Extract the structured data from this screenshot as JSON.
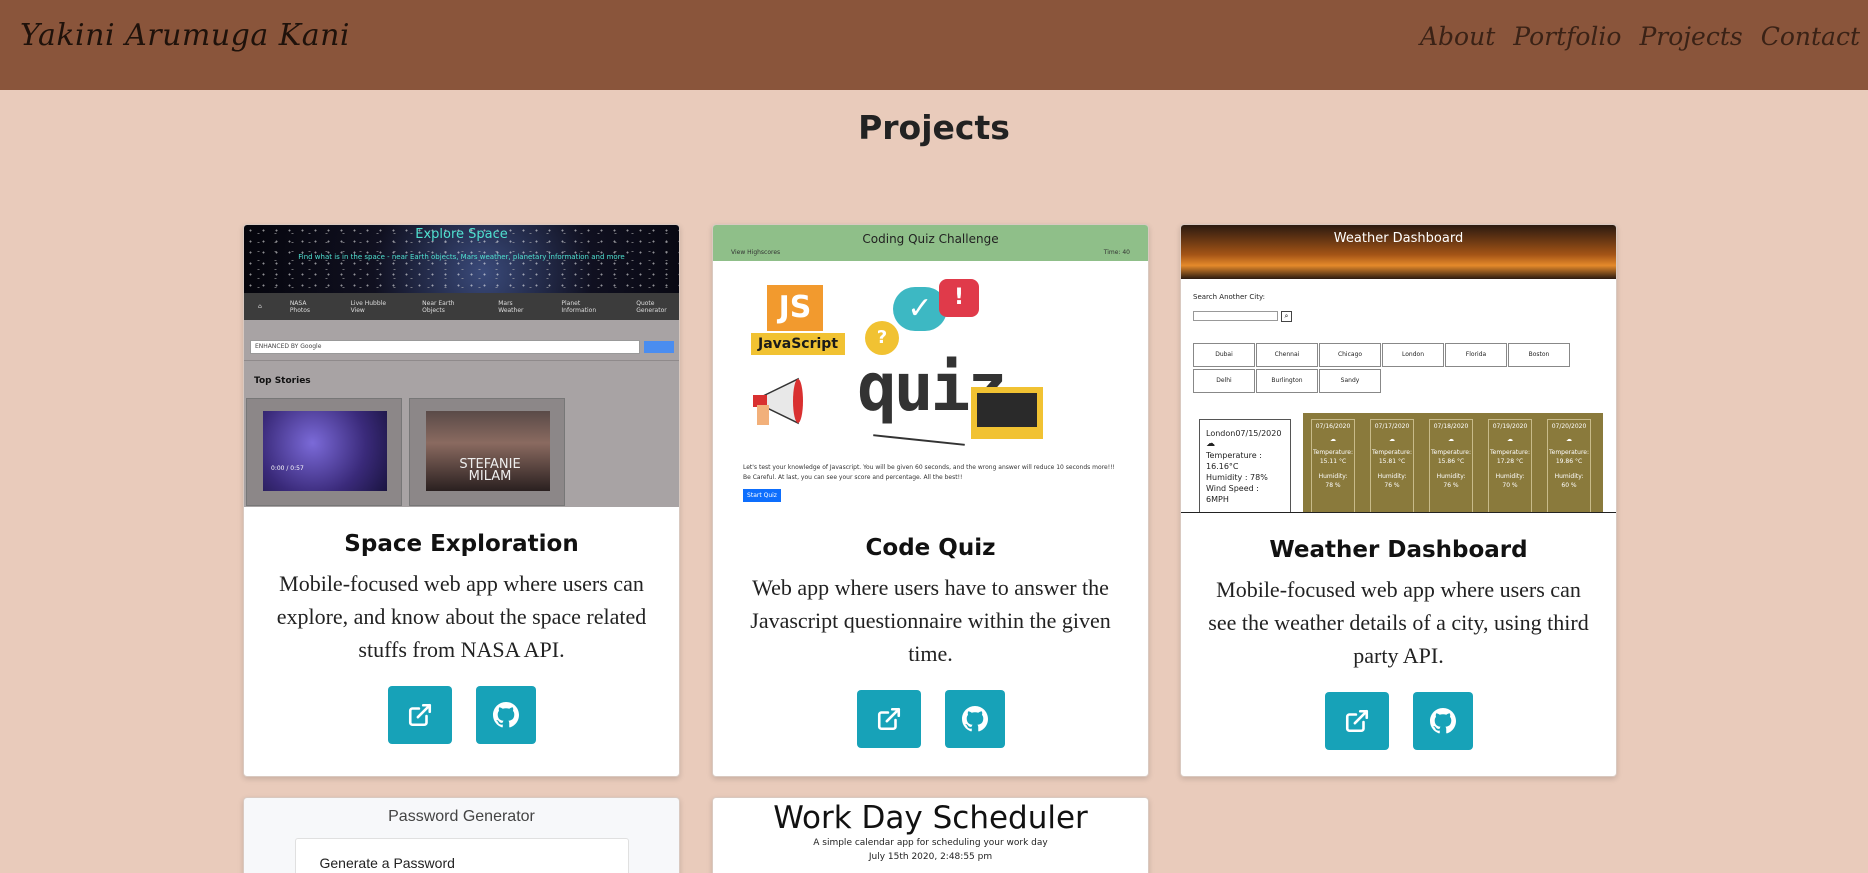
{
  "header": {
    "brand": "Yakini Arumuga Kani",
    "nav": [
      "About",
      "Portfolio",
      "Projects",
      "Contact"
    ]
  },
  "page_title": "Projects",
  "colors": {
    "navbar": "#8a553b",
    "background": "#e9cbbb",
    "button": "#17a2b8"
  },
  "projects": [
    {
      "title": "Space Exploration",
      "description": "Mobile-focused web app where users can explore, and know about the space related stuffs from NASA API.",
      "buttons": [
        "external-link-icon",
        "github-icon"
      ],
      "screenshot": {
        "title": "Explore Space",
        "subtitle": "Find what is in the space - near Earth objects, Mars weather, planetary information and more",
        "nav": [
          "NASA Photos",
          "Live Hubble View",
          "Near Earth Objects",
          "Mars Weather",
          "Planet Information",
          "Quote Generator"
        ],
        "search": "ENHANCED BY Google",
        "top_stories": "Top Stories",
        "video_time": "0:00 / 0:57",
        "video2_caption": "STEFANIE MILAM"
      }
    },
    {
      "title": "Code Quiz",
      "description": "Web app where users have to answer the Javascript questionnaire within the given time.",
      "buttons": [
        "external-link-icon",
        "github-icon"
      ],
      "screenshot": {
        "title": "Coding Quiz Challenge",
        "left": "View Highscores",
        "right": "Time: 40",
        "badge_js": "JS",
        "badge_javascript": "JavaScript",
        "word": "quiz",
        "desc": "Let's test your knowledge of Javascript. You will be given 60 seconds, and the wrong answer will reduce 10 seconds more!!! Be Careful. At last, you can see your score and percentage. All the best!!",
        "start": "Start Quiz"
      }
    },
    {
      "title": "Weather Dashboard",
      "description": "Mobile-focused web app where users can see the weather details of a city, using third party API.",
      "buttons": [
        "external-link-icon",
        "github-icon"
      ],
      "screenshot": {
        "title": "Weather Dashboard",
        "search_label": "Search Another City:",
        "cities": [
          "Dubai",
          "Chennai",
          "Chicago",
          "London",
          "Florida",
          "Boston",
          "Delhi",
          "Burlington",
          "Sandy"
        ],
        "today": {
          "city_date": "London07/15/2020",
          "temperature": "Temperature : 16.16°C",
          "humidity": "Humidity : 78%",
          "wind": "Wind Speed : 6MPH"
        },
        "forecast": [
          {
            "date": "07/16/2020",
            "temp": "15.11 °C",
            "hum": "78 %"
          },
          {
            "date": "07/17/2020",
            "temp": "15.81 °C",
            "hum": "76 %"
          },
          {
            "date": "07/18/2020",
            "temp": "15.86 °C",
            "hum": "76 %"
          },
          {
            "date": "07/19/2020",
            "temp": "17.28 °C",
            "hum": "70 %"
          },
          {
            "date": "07/20/2020",
            "temp": "19.86 °C",
            "hum": "60 %"
          }
        ],
        "temperature_label": "Temperature:",
        "humidity_label": "Humidity:"
      }
    }
  ],
  "partial_cards": [
    {
      "title": "Password Generator",
      "inner": "Generate a Password"
    },
    {
      "title": "Work Day Scheduler",
      "sub": "A simple calendar app for scheduling your work day",
      "date": "July 15th 2020, 2:48:55 pm"
    }
  ]
}
